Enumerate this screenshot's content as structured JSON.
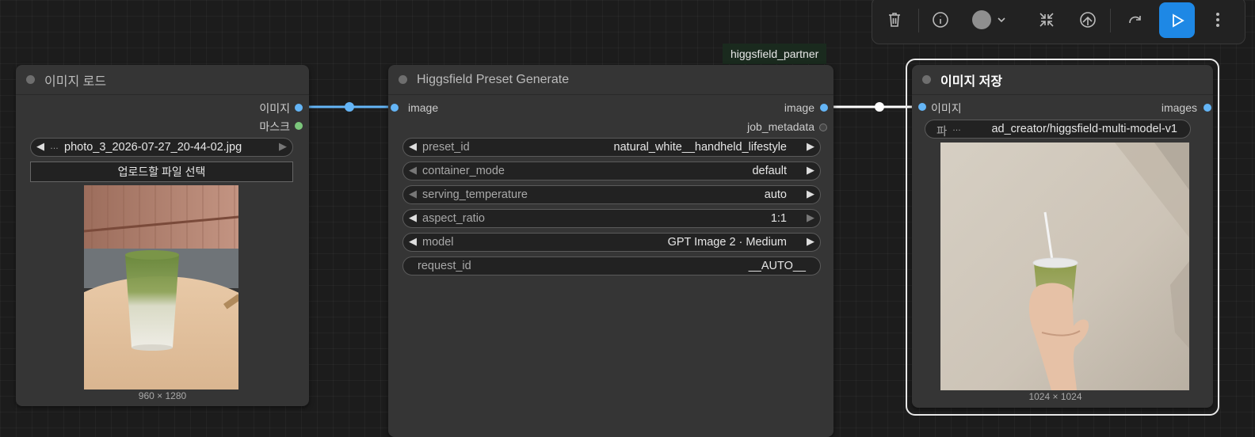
{
  "toolbar": {
    "delete_icon": "trash-icon",
    "info_icon": "info-icon",
    "color_swatch": "#8f8f8f",
    "collapse_icon": "collapse-icon",
    "bypass_icon": "bypass-icon",
    "redo_icon": "redo-icon",
    "run_icon": "play-icon",
    "more_icon": "more-vertical-icon",
    "run_color": "#1e88e5"
  },
  "badge": {
    "label": "higgsfield_partner"
  },
  "load_image": {
    "title": "이미지 로드",
    "outputs": [
      "이미지",
      "마스크"
    ],
    "file_value": "photo_3_2026-07-27_20-44-02.jpg",
    "file_prefix": "…",
    "upload_button": "업로드할 파일 선택",
    "dimensions": "960 × 1280"
  },
  "preset_node": {
    "title": "Higgsfield Preset Generate",
    "input": "image",
    "outputs": [
      "image",
      "job_metadata"
    ],
    "widgets": [
      {
        "label": "preset_id",
        "value": "natural_white__handheld_lifestyle"
      },
      {
        "label": "container_mode",
        "value": "default"
      },
      {
        "label": "serving_temperature",
        "value": "auto"
      },
      {
        "label": "aspect_ratio",
        "value": "1:1"
      },
      {
        "label": "model",
        "value": "GPT Image 2 · Medium"
      },
      {
        "label": "request_id",
        "value": "__AUTO__"
      }
    ]
  },
  "save_image": {
    "title": "이미지 저장",
    "input": "이미지",
    "output": "images",
    "prefix_label": "파",
    "prefix_ellipsis": "…",
    "prefix_value": "ad_creator/higgsfield-multi-model-v1",
    "dimensions": "1024 × 1024"
  }
}
